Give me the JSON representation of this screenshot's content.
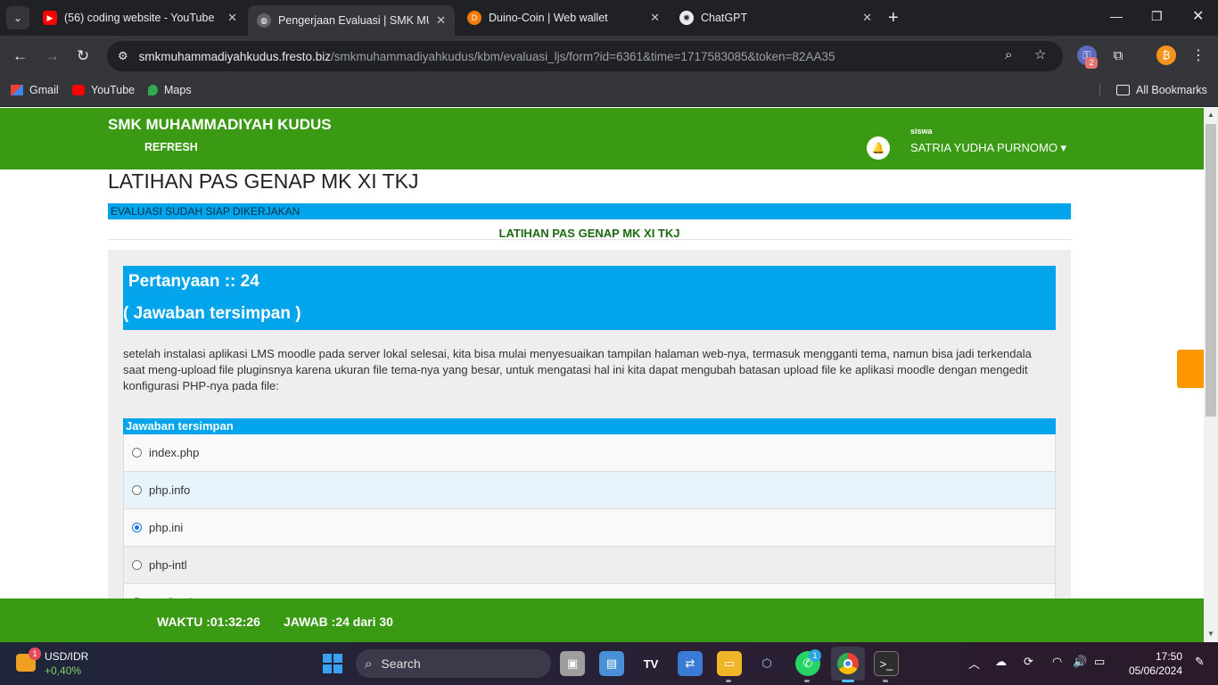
{
  "tabs": [
    {
      "title": "(56) coding website - YouTube",
      "icon": "youtube-icon"
    },
    {
      "title": "Pengerjaan Evaluasi | SMK MUH",
      "icon": "globe-icon"
    },
    {
      "title": "Duino-Coin | Web wallet",
      "icon": "duino-coin-icon"
    },
    {
      "title": "ChatGPT",
      "icon": "chatgpt-icon"
    }
  ],
  "address_bar": {
    "host": "smkmuhammadiyahkudus.fresto.biz",
    "path": "/smkmuhammadiyahkudus/kbm/evaluasi_ljs/form?id=6361&time=1717583085&token=82AA35"
  },
  "extensions": {
    "badge_count": "2"
  },
  "bookmarks": [
    "Gmail",
    "YouTube",
    "Maps"
  ],
  "all_bookmarks": "All Bookmarks",
  "site": {
    "brand": "SMK MUHAMMADIYAH KUDUS",
    "refresh": "REFRESH",
    "role": "siswa",
    "user": "SATRIA YUDHA PURNOMO ▾"
  },
  "page": {
    "title": "LATIHAN PAS GENAP MK XI TKJ",
    "alert": "EVALUASI SUDAH SIAP DIKERJAKAN",
    "subtitle": "LATIHAN PAS GENAP MK XI TKJ"
  },
  "question": {
    "number_label": "Pertanyaan :: 24",
    "status": "( Jawaban tersimpan )",
    "text": "setelah instalasi aplikasi LMS moodle pada server lokal selesai, kita bisa mulai menyesuaikan tampilan halaman web-nya, termasuk mengganti tema, namun bisa jadi terkendala saat meng-upload file pluginsnya karena ukuran file tema-nya yang besar, untuk mengatasi hal ini kita dapat mengubah batasan upload file ke aplikasi moodle dengan mengedit konfigurasi PHP-nya pada file:",
    "answers_header": "Jawaban tersimpan",
    "options": [
      {
        "label": "index.php",
        "checked": false,
        "bg": "#f9f9f9"
      },
      {
        "label": "php.info",
        "checked": false,
        "bg": "#e8f4fc"
      },
      {
        "label": "php.ini",
        "checked": true,
        "bg": "#f9f9f9"
      },
      {
        "label": "php-intl",
        "checked": false,
        "bg": "#eeeeee"
      },
      {
        "label": "config.php",
        "checked": false,
        "bg": "#f9f9f9"
      }
    ]
  },
  "footer": {
    "time": "WAKTU :01:32:26",
    "answered": "JAWAB :24 dari 30"
  },
  "taskbar": {
    "ticker_name": "USD/IDR",
    "ticker_change": "+0,40%",
    "ticker_badge": "1",
    "search_placeholder": "Search",
    "whatsapp_badge": "1",
    "time": "17:50",
    "date": "05/06/2024"
  }
}
